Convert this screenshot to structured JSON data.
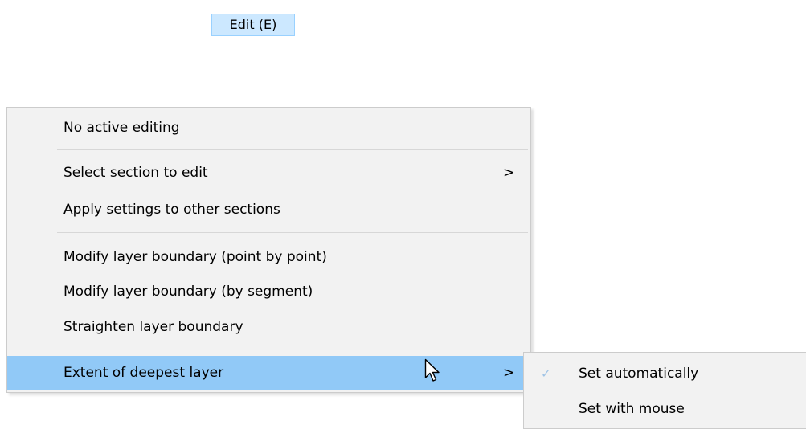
{
  "menubar": {
    "edit_label": "Edit (E)"
  },
  "menu": {
    "items": [
      {
        "label": "No active editing"
      },
      {
        "label": "Select section to edit",
        "chevron": ">"
      },
      {
        "label": "Apply settings to other sections"
      },
      {
        "label": "Modify layer boundary (point by point)"
      },
      {
        "label": "Modify layer boundary (by segment)"
      },
      {
        "label": "Straighten layer boundary"
      },
      {
        "label": "Extent of deepest layer",
        "chevron": ">",
        "highlighted": true
      }
    ]
  },
  "submenu": {
    "items": [
      {
        "label": "Set automatically",
        "checked": true,
        "check_glyph": "✓"
      },
      {
        "label": "Set with mouse",
        "checked": false
      }
    ]
  },
  "colors": {
    "menubar_highlight": "#cce8ff",
    "menu_background": "#f2f2f2",
    "item_highlight": "#91c9f7",
    "check_color": "#a0c4e6"
  },
  "icons": {
    "cursor": "mouse-pointer-icon",
    "chevron": "chevron-right-icon",
    "check": "checkmark-icon"
  }
}
